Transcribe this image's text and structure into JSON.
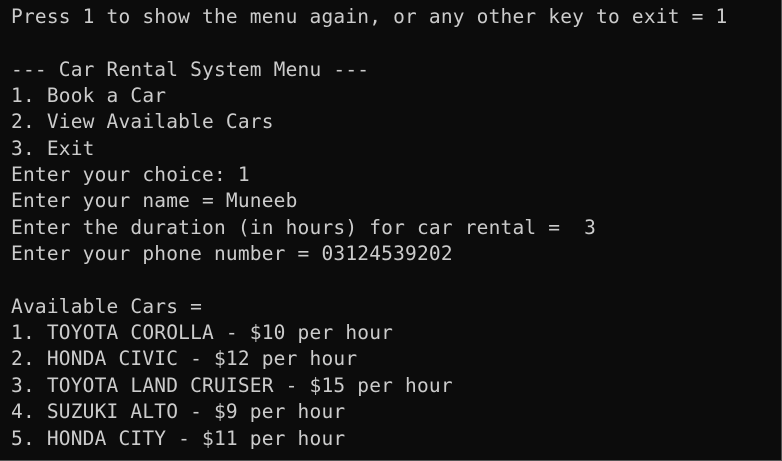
{
  "terminal": {
    "lines": [
      "Press 1 to show the menu again, or any other key to exit = 1",
      "",
      "--- Car Rental System Menu ---",
      "1. Book a Car",
      "2. View Available Cars",
      "3. Exit",
      "Enter your choice: 1",
      "Enter your name = Muneeb",
      "Enter the duration (in hours) for car rental =  3",
      "Enter your phone number = 03124539202",
      "",
      "Available Cars =",
      "1. TOYOTA COROLLA - $10 per hour",
      "2. HONDA CIVIC - $12 per hour",
      "3. TOYOTA LAND CRUISER - $15 per hour",
      "4. SUZUKI ALTO - $9 per hour",
      "5. HONDA CITY - $11 per hour"
    ]
  },
  "colors": {
    "background": "#0c0c0c",
    "foreground": "#cccccc"
  }
}
